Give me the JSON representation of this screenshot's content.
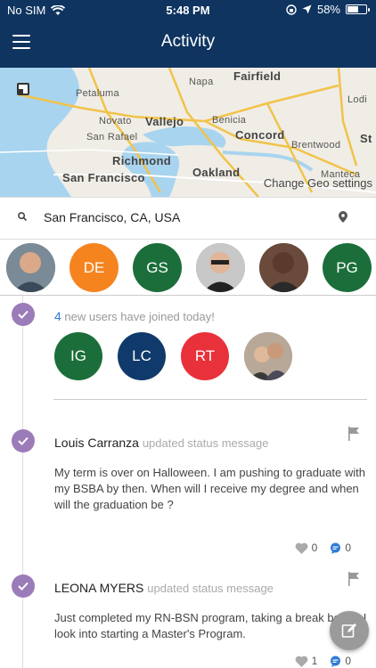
{
  "status_bar": {
    "carrier": "No SIM",
    "time": "5:48 PM",
    "battery": "58%"
  },
  "header": {
    "title": "Activity"
  },
  "map": {
    "labels": [
      "Fairfield",
      "Napa",
      "Petaluma",
      "Novato",
      "Vallejo",
      "Benicia",
      "San Rafael",
      "Concord",
      "Brentwood",
      "Richmond",
      "San Francisco",
      "Oakland",
      "Manteca",
      "Lodi",
      "St"
    ],
    "change_geo": "Change Geo settings"
  },
  "search": {
    "location": "San Francisco, CA, USA"
  },
  "colors": {
    "navy": "#0f3460",
    "purple": "#9b7bb8",
    "orange": "#f5841f",
    "green": "#1b6e3a",
    "blue": "#0f3a6b",
    "red": "#e8313a",
    "accent_blue": "#2f7bd6"
  },
  "avatar_strip": [
    {
      "initials": "",
      "type": "photo"
    },
    {
      "initials": "DE",
      "color": "#f5841f"
    },
    {
      "initials": "GS",
      "color": "#1b6e3a"
    },
    {
      "initials": "",
      "type": "photo"
    },
    {
      "initials": "",
      "type": "photo"
    },
    {
      "initials": "PG",
      "color": "#1b6e3a"
    }
  ],
  "new_users": {
    "count": "4",
    "text": "new users have joined today!",
    "avatars": [
      {
        "initials": "IG",
        "color": "#1b6e3a"
      },
      {
        "initials": "LC",
        "color": "#0f3a6b"
      },
      {
        "initials": "RT",
        "color": "#e8313a"
      },
      {
        "initials": "",
        "type": "photo"
      }
    ]
  },
  "posts": [
    {
      "author": "Louis Carranza",
      "action": "updated status message",
      "body": "My term is over on Halloween. I am pushing to graduate with my BSBA by then. When will I receive my degree and when will the graduation be ?",
      "likes": "0",
      "comments": "0"
    },
    {
      "author": "LEONA MYERS",
      "action": "updated status message",
      "body": "Just completed my RN-BSN program, taking a break before I look into starting a Master's Program.",
      "likes": "1",
      "comments": "0"
    }
  ]
}
